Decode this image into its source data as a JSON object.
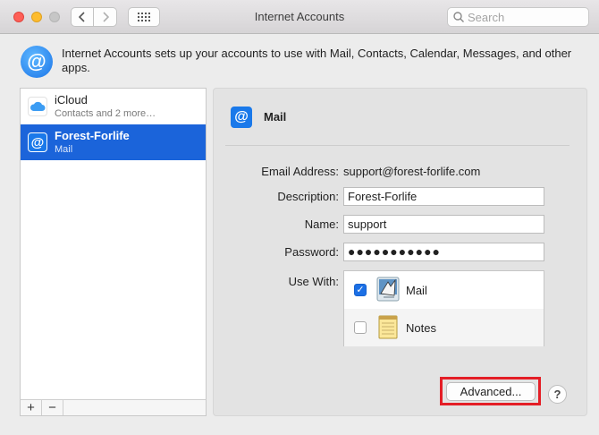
{
  "window": {
    "title": "Internet Accounts",
    "search_placeholder": "Search"
  },
  "header": {
    "description": "Internet Accounts sets up your accounts to use with Mail, Contacts, Calendar, Messages, and other apps."
  },
  "accounts": [
    {
      "name": "iCloud",
      "subtitle": "Contacts and 2 more…",
      "icon": "icloud-icon",
      "selected": false
    },
    {
      "name": "Forest-Forlife",
      "subtitle": "Mail",
      "icon": "mail-at-icon",
      "selected": true
    }
  ],
  "list_footer": {
    "add_label": "+",
    "remove_label": "−"
  },
  "detail": {
    "title": "Mail",
    "email_label": "Email Address:",
    "email_value": "support@forest-forlife.com",
    "description_label": "Description:",
    "description_value": "Forest-Forlife",
    "name_label": "Name:",
    "name_value": "support",
    "password_label": "Password:",
    "password_value": "●●●●●●●●●●●",
    "use_with_label": "Use With:",
    "use_with": [
      {
        "app": "Mail",
        "checked": true
      },
      {
        "app": "Notes",
        "checked": false
      }
    ],
    "advanced_label": "Advanced...",
    "help_label": "?"
  },
  "colors": {
    "selection": "#1b64da",
    "highlight_box": "#e41e26",
    "checkbox_on": "#1b6fe5"
  }
}
